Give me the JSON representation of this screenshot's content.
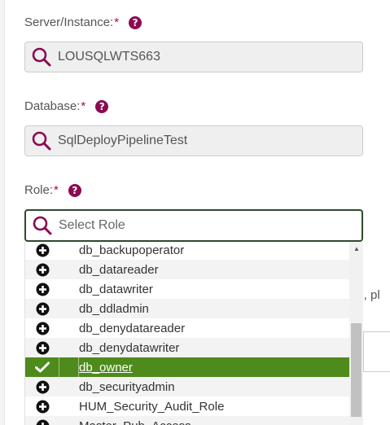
{
  "server": {
    "label": "Server/Instance:",
    "required_mark": "*",
    "value": "LOUSQLWTS663"
  },
  "database": {
    "label": "Database:",
    "required_mark": "*",
    "value": "SqlDeployPipelineTest"
  },
  "role": {
    "label": "Role:",
    "required_mark": "*",
    "placeholder": "Select Role",
    "options": [
      {
        "label": "db_backupoperator",
        "selected": false
      },
      {
        "label": "db_datareader",
        "selected": false
      },
      {
        "label": "db_datawriter",
        "selected": false
      },
      {
        "label": "db_ddladmin",
        "selected": false
      },
      {
        "label": "db_denydatareader",
        "selected": false
      },
      {
        "label": "db_denydatawriter",
        "selected": false
      },
      {
        "label": "db_owner",
        "selected": true
      },
      {
        "label": "db_securityadmin",
        "selected": false
      },
      {
        "label": "HUM_Security_Audit_Role",
        "selected": false
      },
      {
        "label": "Master_Pub_Access",
        "selected": false
      }
    ]
  },
  "help_glyph": "?",
  "behind_text": "nd, pl",
  "colors": {
    "brand": "#8b0a52",
    "selected_bg": "#4e8a1c",
    "active_border": "#2e4a2b"
  },
  "icons": {
    "search": "magnifier-icon",
    "add": "plus-circle-icon",
    "selected": "check-icon",
    "help": "question-circle-icon"
  }
}
